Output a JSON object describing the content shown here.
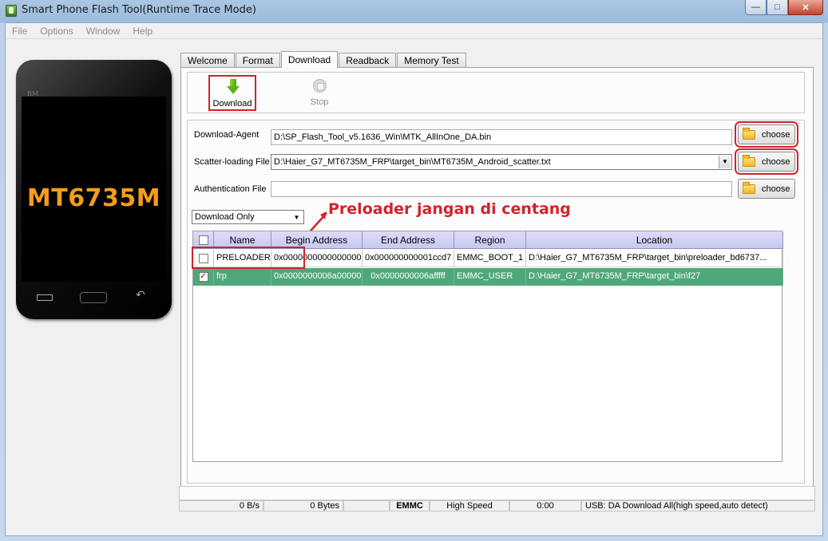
{
  "window": {
    "title": "Smart Phone Flash Tool(Runtime Trace Mode)"
  },
  "menu": [
    "File",
    "Options",
    "Window",
    "Help"
  ],
  "phone": {
    "brand": "BM",
    "model": "MT6735M"
  },
  "tabs": [
    "Welcome",
    "Format",
    "Download",
    "Readback",
    "Memory Test"
  ],
  "toolbar": {
    "download_label": "Download",
    "stop_label": "Stop"
  },
  "files": {
    "download_agent_label": "Download-Agent",
    "download_agent_value": "D:\\SP_Flash_Tool_v5.1636_Win\\MTK_AllInOne_DA.bin",
    "scatter_label": "Scatter-loading File",
    "scatter_value": "D:\\Haier_G7_MT6735M_FRP\\target_bin\\MT6735M_Android_scatter.txt",
    "auth_label": "Authentication File",
    "auth_value": "",
    "choose_label": "choose"
  },
  "mode": {
    "selected": "Download Only"
  },
  "annotation": "Preloader jangan di centang",
  "table": {
    "headers": [
      "",
      "Name",
      "Begin Address",
      "End Address",
      "Region",
      "Location"
    ],
    "rows": [
      {
        "checked": false,
        "name": "PRELOADER",
        "begin": "0x0000000000000000",
        "end": "0x000000000001ccd7",
        "region": "EMMC_BOOT_1",
        "location": "D:\\Haier_G7_MT6735M_FRP\\target_bin\\preloader_bd6737..."
      },
      {
        "checked": true,
        "name": "frp",
        "begin": "0x0000000006a00000",
        "end": "0x0000000006afffff",
        "region": "EMMC_USER",
        "location": "D:\\Haier_G7_MT6735M_FRP\\target_bin\\f27"
      }
    ]
  },
  "status": {
    "speed": "0 B/s",
    "bytes": "0 Bytes",
    "storage": "EMMC",
    "mode": "High Speed",
    "time": "0:00",
    "usb": "USB: DA Download All(high speed,auto detect)"
  },
  "colors": {
    "selected_row": "#4fa87a",
    "highlight": "#d2232a",
    "model_text": "#f39c1e"
  }
}
